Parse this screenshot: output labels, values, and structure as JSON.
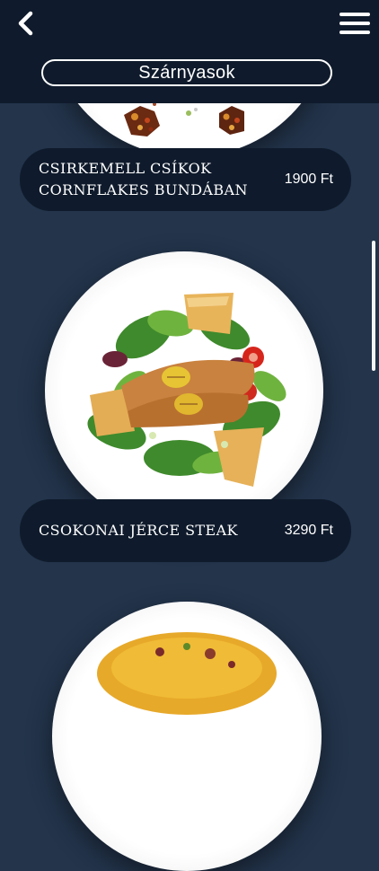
{
  "header": {
    "back_icon": "chevron-left-icon",
    "menu_icon": "hamburger-menu-icon",
    "category_title": "Szárnyasok"
  },
  "dishes": [
    {
      "name_line1": "CSIRKEMELL CSÍKOK",
      "name_line2": "CORNFLAKES BUNDÁBAN",
      "price": "1900 Ft",
      "image": "chicken-strips-plate-image"
    },
    {
      "name_line1": "CSOKONAI JÉRCE STEAK",
      "name_line2": "",
      "price": "3290 Ft",
      "image": "chicken-steak-salad-plate-image"
    },
    {
      "name_line1": "",
      "name_line2": "",
      "price": "",
      "image": "rice-dish-plate-image"
    }
  ],
  "colors": {
    "background": "#23344b",
    "header": "#0f1b2c",
    "pill": "#0f1b2c",
    "text": "#ffffff"
  }
}
